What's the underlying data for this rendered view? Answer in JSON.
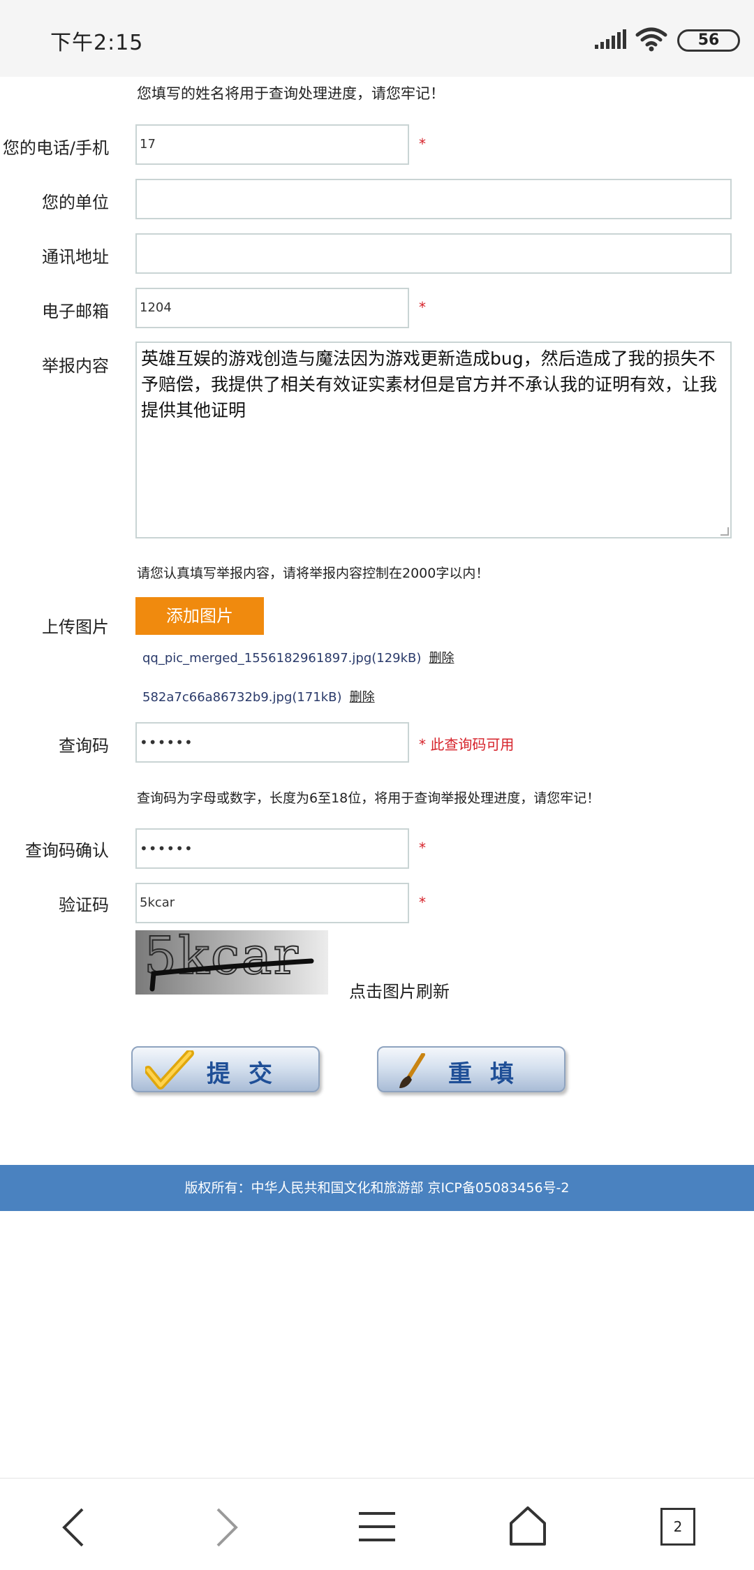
{
  "status_bar": {
    "time": "下午2:15",
    "battery": "56",
    "icons": [
      "signal-icon",
      "wifi-icon",
      "battery-icon"
    ]
  },
  "form": {
    "name_note": "您填写的姓名将用于查询处理进度，请您牢记！",
    "phone": {
      "label": "您的电话/手机",
      "value": "17",
      "required": "*"
    },
    "company": {
      "label": "您的单位",
      "value": ""
    },
    "address": {
      "label": "通讯地址",
      "value": ""
    },
    "email": {
      "label": "电子邮箱",
      "value": "1204",
      "required": "*"
    },
    "report": {
      "label": "举报内容",
      "value": "英雄互娱的游戏创造与魔法因为游戏更新造成bug，然后造成了我的损失不予赔偿，我提供了相关有效证实素材但是官方并不承认我的证明有效，让我提供其他证明",
      "note": "请您认真填写举报内容，请将举报内容控制在2000字以内！"
    },
    "upload": {
      "label": "上传图片",
      "button": "添加图片",
      "files": [
        {
          "name": "qq_pic_merged_1556182961897.jpg(129kB)",
          "delete": "删除"
        },
        {
          "name": "582a7c66a86732b9.jpg(171kB)",
          "delete": "删除"
        }
      ]
    },
    "query_code": {
      "label": "查询码",
      "value": "••••••",
      "status": "* 此查询码可用",
      "note": "查询码为字母或数字，长度为6至18位，将用于查询举报处理进度，请您牢记！"
    },
    "query_code_confirm": {
      "label": "查询码确认",
      "value": "••••••",
      "required": "*"
    },
    "captcha": {
      "label": "验证码",
      "value": "5kcar",
      "required": "*",
      "image_text": "5kcar",
      "refresh_text": "点击图片刷新"
    },
    "buttons": {
      "submit": "提交",
      "reset": "重填"
    }
  },
  "footer": {
    "text": "版权所有：中华人民共和国文化和旅游部  京ICP备05083456号-2"
  },
  "nav_bar": {
    "tab_count": "2",
    "icons": [
      "back-icon",
      "forward-icon",
      "menu-icon",
      "home-icon",
      "tabs-icon"
    ]
  },
  "colors": {
    "accent_orange": "#f08a0e",
    "footer_blue": "#4a82c0",
    "required_red": "#d6222a",
    "button_text_blue": "#1f4f97"
  }
}
